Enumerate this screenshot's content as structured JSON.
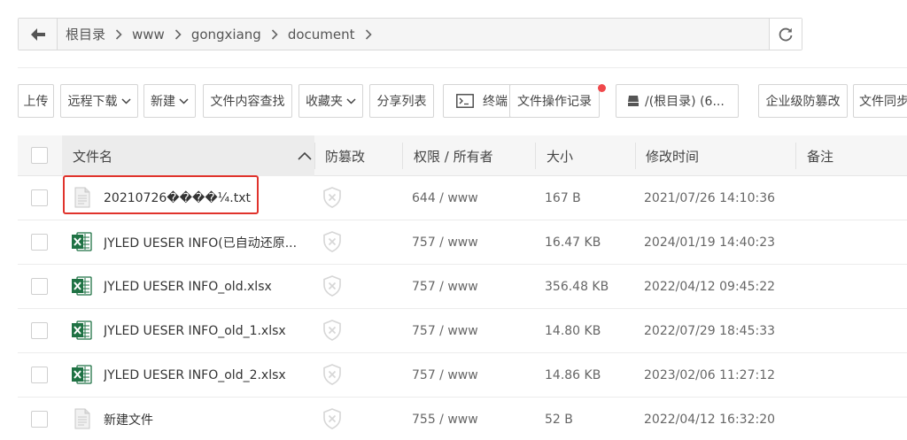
{
  "breadcrumb": {
    "items": [
      "根目录",
      "www",
      "gongxiang",
      "document"
    ]
  },
  "toolbar": {
    "upload": "上传",
    "remote_download": "远程下载",
    "new": "新建",
    "content_search": "文件内容查找",
    "favorites": "收藏夹",
    "share_list": "分享列表",
    "terminal": "终端",
    "file_log": "文件操作记录",
    "disk": "/(根目录) (6...",
    "tamper_proof": "企业级防篡改",
    "file_sync": "文件同步"
  },
  "table": {
    "headers": {
      "name": "文件名",
      "tamper": "防篡改",
      "perm": "权限 / 所有者",
      "size": "大小",
      "mtime": "修改时间",
      "note": "备注"
    },
    "rows": [
      {
        "name": "20210726����¼.txt",
        "type": "txt",
        "perm": "644 / www",
        "size": "167 B",
        "mtime": "2021/07/26 14:10:36"
      },
      {
        "name": "JYLED UESER INFO(已自动还原...",
        "type": "xlsx",
        "perm": "757 / www",
        "size": "16.47 KB",
        "mtime": "2024/01/19 14:40:23"
      },
      {
        "name": "JYLED UESER INFO_old.xlsx",
        "type": "xlsx",
        "perm": "757 / www",
        "size": "356.48 KB",
        "mtime": "2022/04/12 09:45:22"
      },
      {
        "name": "JYLED UESER INFO_old_1.xlsx",
        "type": "xlsx",
        "perm": "757 / www",
        "size": "14.80 KB",
        "mtime": "2022/07/29 18:45:33"
      },
      {
        "name": "JYLED UESER INFO_old_2.xlsx",
        "type": "xlsx",
        "perm": "757 / www",
        "size": "14.86 KB",
        "mtime": "2023/02/06 11:27:12"
      },
      {
        "name": "新建文件",
        "type": "txt",
        "perm": "755 / www",
        "size": "52 B",
        "mtime": "2022/04/12 16:32:20"
      }
    ]
  },
  "colors": {
    "excel_green": "#1f7244",
    "highlight_red": "#e0332c",
    "notification_dot": "#f0484b"
  }
}
